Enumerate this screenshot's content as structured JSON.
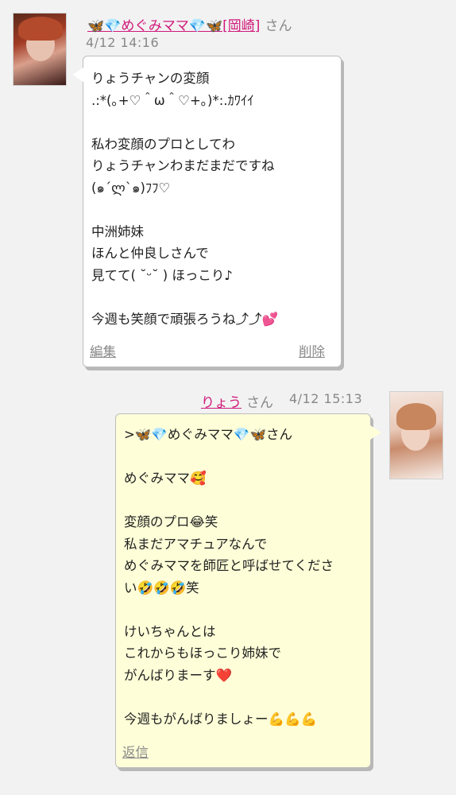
{
  "post1": {
    "sender": "🦋💎めぐみママ💎🦋[岡崎]",
    "suffix": "さん",
    "date": "4/12 14:16",
    "message": "りょうチャンの変顔\n.:*(｡+♡＾ω＾♡+｡)*:.ｶﾜｲｲ\n\n私わ変顔のプロとしてわ\nりょうチャンわまだまだですね\n(๑´ლ`๑)ﾌﾌ♡\n\n中洲姉妹\nほんと仲良しさんで\n見てて( ˘ᵕ˘ ) ほっこり♪\n\n今週も笑顔で頑張ろうね⤴︎⤴︎💕",
    "edit_label": "編集",
    "delete_label": "削除"
  },
  "post2": {
    "sender": "りょう",
    "suffix": "さん",
    "date": "4/12 15:13",
    "message": ">🦋💎めぐみママ💎🦋さん\n\nめぐみママ🥰\n\n変顔のプロ😂笑\n私まだアマチュアなんで\nめぐみママを師匠と呼ばせてくださ\nい🤣🤣🤣笑\n\nけいちゃんとは\nこれからもほっこり姉妹で\nがんばりまーす❤️\n\n今週もがんばりましょー💪💪💪",
    "reply_label": "返信"
  },
  "colors": {
    "sender_link": "#d0197a",
    "meta_gray": "#888888",
    "bubble_left_bg": "#ffffff",
    "bubble_right_bg": "#fefed8",
    "page_bg": "#f2f2f2"
  }
}
